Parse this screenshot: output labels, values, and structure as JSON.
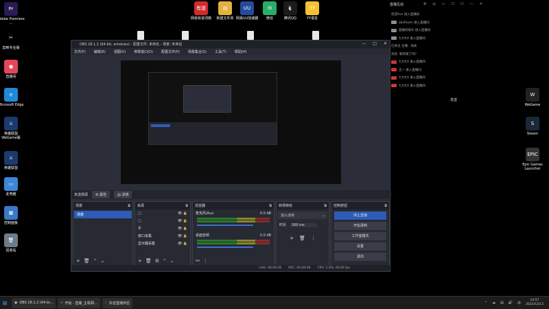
{
  "desktop_left": [
    {
      "name": "pr-icon",
      "label": "Adobe Premiere ...",
      "color": "#2a1a55",
      "glyph": "Pr"
    },
    {
      "name": "jianying-icon",
      "label": "剪映专业版",
      "color": "#000000",
      "glyph": "✂"
    },
    {
      "name": "zhibojian-icon",
      "label": "直播间",
      "color": "#e8455a",
      "glyph": "●"
    },
    {
      "name": "edge-icon",
      "label": "Microsoft Edge",
      "color": "#1f8ad6",
      "glyph": "e"
    },
    {
      "name": "lol-wegame-icon",
      "label": "英雄联盟 WeGame版",
      "color": "#1b3a6e",
      "glyph": "⚔"
    },
    {
      "name": "lol-icon",
      "label": "英雄联盟",
      "color": "#1b3a6e",
      "glyph": "⚔"
    },
    {
      "name": "this-pc-icon",
      "label": "此电脑",
      "color": "#3b87d6",
      "glyph": "▭"
    },
    {
      "name": "control-panel-icon",
      "label": "控制面板",
      "color": "#3a78c8",
      "glyph": "▦"
    },
    {
      "name": "recycle-bin-icon",
      "label": "回收站",
      "color": "#6d7b8a",
      "glyph": "🗑"
    }
  ],
  "desktop_top": [
    {
      "name": "netease-cloud-icon",
      "label": "网易有道词典",
      "color": "#d12b2b",
      "glyph": "有道"
    },
    {
      "name": "new-folder-icon",
      "label": "新建文件夹",
      "color": "#e3b23c",
      "glyph": "▤"
    },
    {
      "name": "netease-uu-icon",
      "label": "网易UU加速器",
      "color": "#244a9e",
      "glyph": "UU"
    },
    {
      "name": "wechat-icon",
      "label": "微信",
      "color": "#2aae67",
      "glyph": "✉"
    },
    {
      "name": "qq-icon",
      "label": "腾讯QQ",
      "color": "#1c1c1c",
      "glyph": "🐧"
    },
    {
      "name": "yy-icon",
      "label": "YY语音",
      "color": "#f2c230",
      "glyph": "YY"
    }
  ],
  "desktop_right": [
    {
      "name": "wegame-icon",
      "label": "WeGame",
      "color": "#222222",
      "glyph": "W"
    },
    {
      "name": "steam-icon",
      "label": "Steam",
      "color": "#1b2838",
      "glyph": "S"
    },
    {
      "name": "epic-icon",
      "label": "Epic Games Launcher",
      "color": "#333333",
      "glyph": "EPIC"
    }
  ],
  "obs": {
    "title": "OBS 28.1.2 (64-bit, windows) - 配置文件: 未命名 - 场景: 未命名",
    "menu": [
      "文件(F)",
      "编辑(E)",
      "视图(V)",
      "停靠窗口(D)",
      "配置文件(P)",
      "场景集合(S)",
      "工具(T)",
      "帮助(H)"
    ],
    "scene_bar": {
      "label": "未选择源",
      "properties": "属性",
      "filters": "滤镜"
    },
    "scenes": {
      "title": "场景",
      "items": [
        "场景"
      ]
    },
    "sources": {
      "title": "来源",
      "items": [
        "□",
        "□",
        "手",
        "窗口采集",
        "显示器采集"
      ]
    },
    "mixer": {
      "title": "混音器",
      "channels": [
        {
          "name": "麦克风/Aux",
          "db": "0.0 dB"
        },
        {
          "name": "桌面音频",
          "db": "0.0 dB"
        }
      ]
    },
    "transitions": {
      "title": "转场特效",
      "type": "淡入淡出",
      "duration_label": "时长",
      "duration": "300 ms"
    },
    "controls": {
      "title": "控制按钮",
      "buttons": [
        "停止直播",
        "开始录制",
        "工作室模式",
        "设置",
        "退出"
      ]
    },
    "status": {
      "live": "LIVE: 00:00:00",
      "rec": "REC: 00:00:00",
      "cpu": "CPU: 2.0%, 60.00 fps"
    }
  },
  "chat": {
    "title": "直播互动",
    "send": "发送",
    "lines": [
      {
        "badge": "",
        "text": "欢迎Xxx 进入直播间",
        "red": false
      },
      {
        "badge": "...",
        "text": "abcRoom 进入直播间",
        "red": false
      },
      {
        "badge": "...",
        "text": "直播间观众 进入直播间",
        "red": false
      },
      {
        "badge": "...",
        "text": "七X大X 进入直播间",
        "red": false
      },
      {
        "badge": "",
        "text": "已关注 主播、加关",
        "red": false
      },
      {
        "badge": "",
        "text": "消息: 聊到来了吗?",
        "red": false
      },
      {
        "badge": "...",
        "text": "七X大X 进入直播间",
        "red": true
      },
      {
        "badge": "...",
        "text": "王一 进入直播间",
        "red": true
      },
      {
        "badge": "...",
        "text": "七X大X 进入直播间",
        "red": true
      },
      {
        "badge": "...",
        "text": "七X大X 进入直播间",
        "red": true
      }
    ]
  },
  "taskbar": {
    "items": [
      {
        "name": "obs-task",
        "label": "OBS 28.1.2 (64-bi..."
      },
      {
        "name": "edge-task",
        "label": "开始 - 直播_主机网..."
      },
      {
        "name": "obs-live-task",
        "label": "抖音直播伴侣"
      }
    ],
    "time": "14:57",
    "date": "2022/12/13"
  }
}
